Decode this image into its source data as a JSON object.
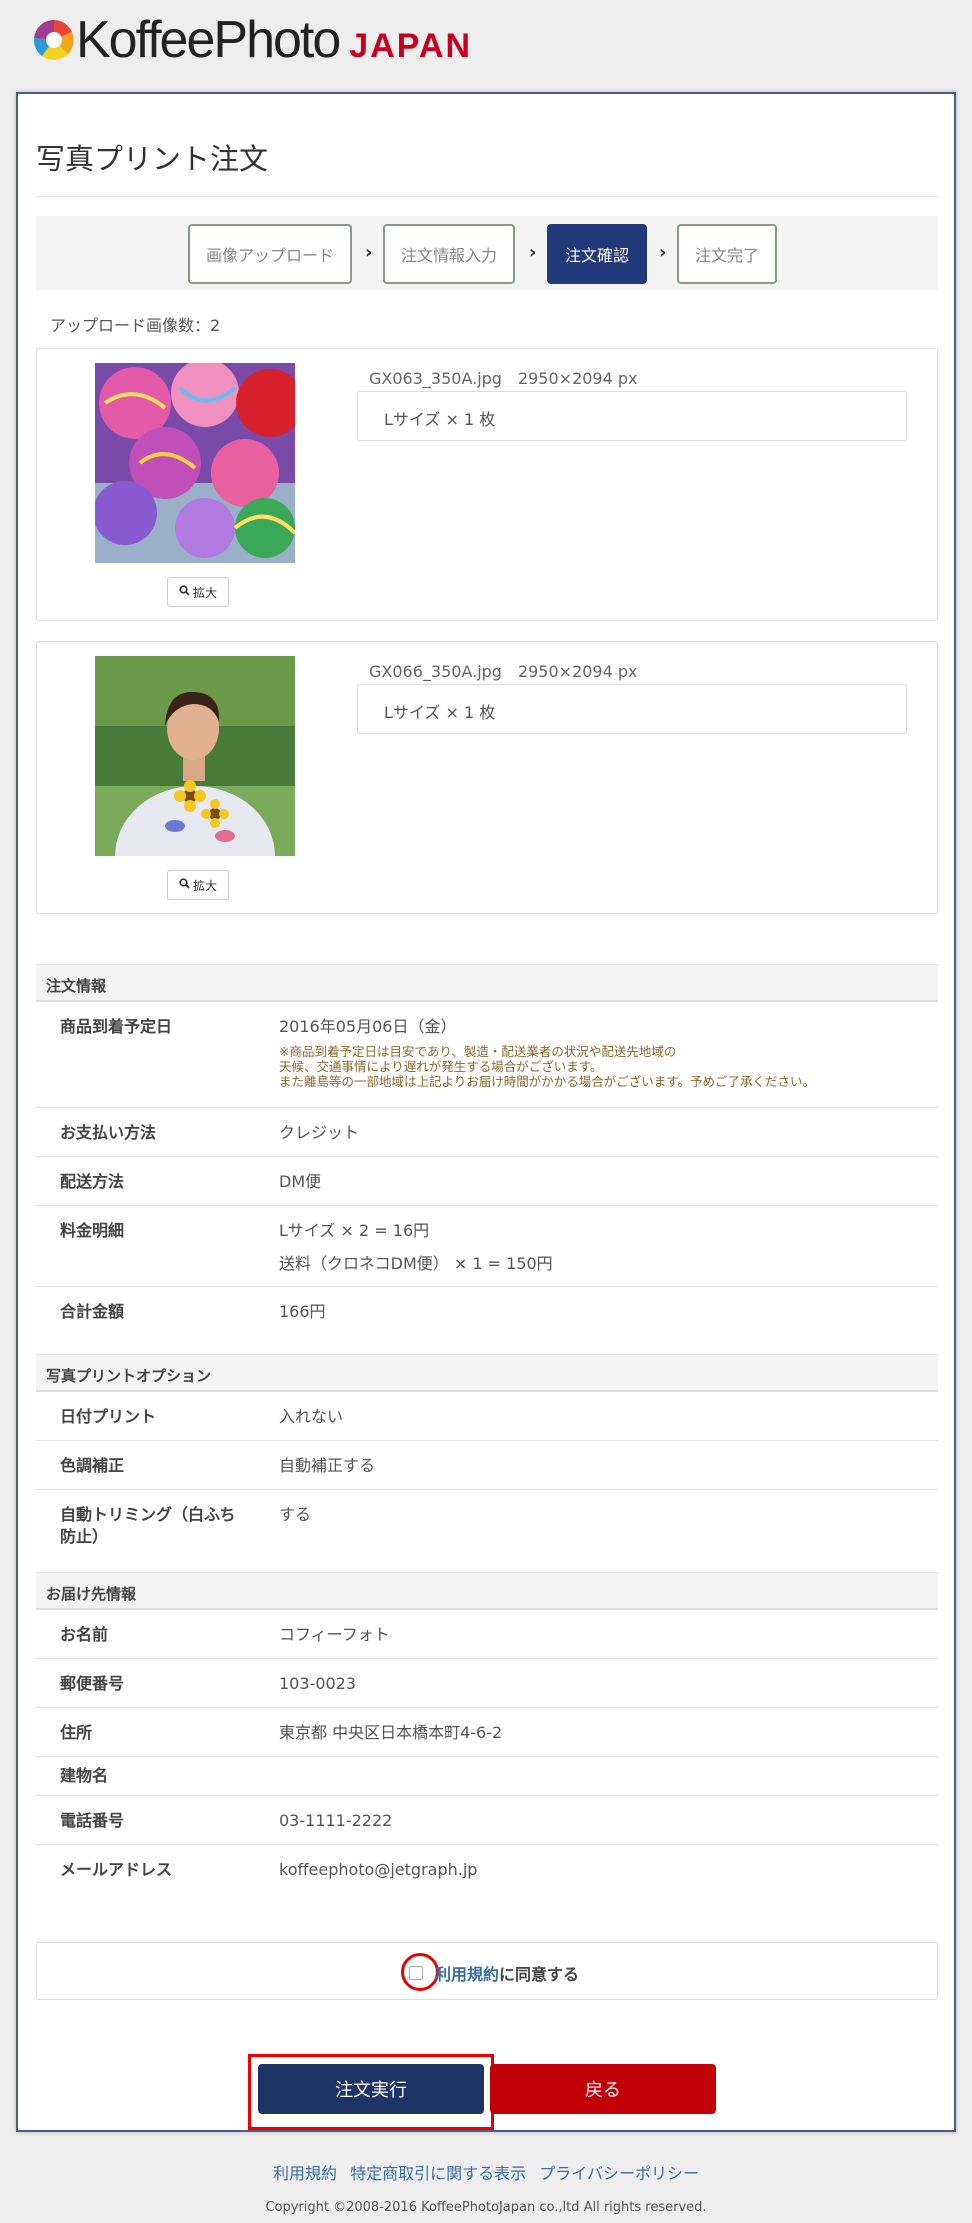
{
  "brand": {
    "logo_text": "KoffeePhoto",
    "logo_region": "JAPAN"
  },
  "page": {
    "title": "写真プリント注文"
  },
  "steps": [
    {
      "label": "画像アップロード"
    },
    {
      "label": "注文情報入力"
    },
    {
      "label": "注文確認"
    },
    {
      "label": "注文完了"
    }
  ],
  "upload_count": "アップロード画像数：2",
  "photos": [
    {
      "file": "GX063_350A.jpg　2950×2094 px",
      "qty": "Lサイズ × 1 枚",
      "zoom_label": "拡大"
    },
    {
      "file": "GX066_350A.jpg　2950×2094 px",
      "qty": "Lサイズ × 1 枚",
      "zoom_label": "拡大"
    }
  ],
  "order_info": {
    "heading": "注文情報",
    "arrival_label": "商品到着予定日",
    "arrival_value": "2016年05月06日（金）",
    "arrival_note_1": "※商品到着予定日は目安であり、製造・配送業者の状況や配送先地域の",
    "arrival_note_2": "天候、交通事情により遅れが発生する場合がございます。",
    "arrival_note_3": "また離島等の一部地域は上記よりお届け時間がかかる場合がございます。予めご了承ください。",
    "payment_label": "お支払い方法",
    "payment_value": "クレジット",
    "shipping_label": "配送方法",
    "shipping_value": "DM便",
    "fee_label": "料金明細",
    "fee_line_1": "Lサイズ × 2 = 16円",
    "fee_line_2": "送料（クロネコDM便） × 1 = 150円",
    "total_label": "合計金額",
    "total_value": "166円"
  },
  "print_options": {
    "heading": "写真プリントオプション",
    "date_label": "日付プリント",
    "date_value": "入れない",
    "color_label": "色調補正",
    "color_value": "自動補正する",
    "trim_label_1": "自動トリミング（白ふち",
    "trim_label_2": "防止）",
    "trim_value": "する"
  },
  "delivery": {
    "heading": "お届け先情報",
    "name_label": "お名前",
    "name_value": "コフィーフォト",
    "zip_label": "郵便番号",
    "zip_value": "103-0023",
    "address_label": "住所",
    "address_value": "東京都 中央区日本橋本町4-6-2",
    "building_label": "建物名",
    "building_value": "",
    "phone_label": "電話番号",
    "phone_value": "03-1111-2222",
    "email_label": "メールアドレス",
    "email_value": "koffeephoto@jetgraph.jp"
  },
  "agree": {
    "link_text": "利用規約",
    "text": "に同意する",
    "checked": false
  },
  "buttons": {
    "submit": "注文実行",
    "back": "戻る"
  },
  "footer": {
    "links": [
      "利用規約",
      "特定商取引に関する表示",
      "プライバシーポリシー"
    ],
    "copyright": "Copyright ©2008-2016 KoffeePhotoJapan co.,ltd All rights reserved."
  },
  "colors": {
    "primary": "#1e3366",
    "danger": "#c20008",
    "brand_red": "#c8001e",
    "link": "#3a6ea5"
  }
}
